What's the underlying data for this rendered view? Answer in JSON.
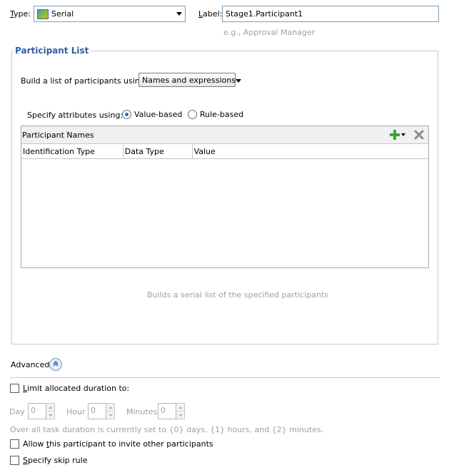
{
  "header": {
    "type_label": "Type:",
    "type_value": "Serial",
    "label_label": "Label:",
    "label_value": "Stage1.Participant1",
    "label_hint": "e.g., Approval Manager"
  },
  "participant_list": {
    "title": "Participant List",
    "build_label": "Build a list of participants using:",
    "build_value": "Names and expressions",
    "specify_label": "Specify attributes using:",
    "radio_value_based": "Value-based",
    "radio_rule_based": "Rule-based",
    "radio_selected": "value-based",
    "table_title": "Participant Names",
    "columns": [
      "Identification Type",
      "Data Type",
      "Value"
    ],
    "rows": [],
    "description": "Builds a serial list of the specified participants"
  },
  "advanced": {
    "label": "Advanced",
    "limit_duration_label": "Limit allocated duration to:",
    "limit_duration_checked": false,
    "day_label": "Day",
    "day_value": "0",
    "hour_label": "Hour",
    "hour_value": "0",
    "minutes_label": "Minutes",
    "minutes_value": "0",
    "duration_note": "Over all task duration is currently set to {0} days, {1} hours, and {2} minutes.",
    "allow_invite_label": "Allow this participant to invite other participants",
    "allow_invite_checked": false,
    "skip_rule_label": "Specify skip rule",
    "skip_rule_checked": false
  },
  "colors": {
    "group_title": "#2e5fa8",
    "add_icon": "#3aa537",
    "remove_icon": "#8a8a8a",
    "disabled_text": "#a0a0a0"
  },
  "icons": {
    "type": "serial-icon",
    "add": "plus-icon",
    "remove": "delete-icon",
    "advanced": "chevron-up-double-icon"
  }
}
